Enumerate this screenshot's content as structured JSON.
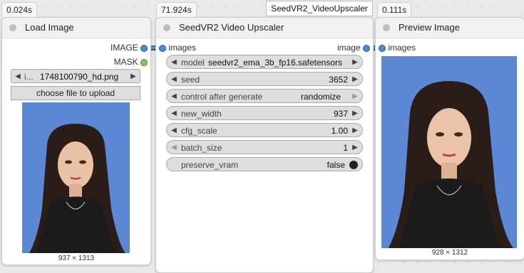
{
  "nodes": {
    "load": {
      "timer": "0.024s",
      "title": "Load Image",
      "outputs": [
        "IMAGE",
        "MASK"
      ],
      "file_widget": {
        "prefix": "i...",
        "value": "1748100790_hd.png"
      },
      "upload_label": "choose file to upload",
      "dims": "937 × 1313"
    },
    "upscaler": {
      "timer": "71.924s",
      "tooltip": "SeedVR2_VideoUpscaler",
      "title": "SeedVR2 Video Upscaler",
      "input": "images",
      "output": "image",
      "widgets": [
        {
          "label": "model",
          "value": "seedvr2_ema_3b_fp16.safetensors"
        },
        {
          "label": "seed",
          "value": "3652"
        },
        {
          "label": "control after generate",
          "value": "randomize"
        },
        {
          "label": "new_width",
          "value": "937"
        },
        {
          "label": "cfg_scale",
          "value": "1.00"
        },
        {
          "label": "batch_size",
          "value": "1"
        },
        {
          "label": "preserve_vram",
          "value": "false"
        }
      ]
    },
    "preview": {
      "timer": "0.111s",
      "title": "Preview Image",
      "input": "images",
      "dims": "928 × 1312"
    }
  },
  "colors": {
    "photo_bg": "#5b87d3",
    "socket_blue": "#4a8fd6",
    "socket_green": "#8fc05c"
  },
  "icons": [
    "left-arrow-icon",
    "right-arrow-icon",
    "toggle-icon"
  ]
}
